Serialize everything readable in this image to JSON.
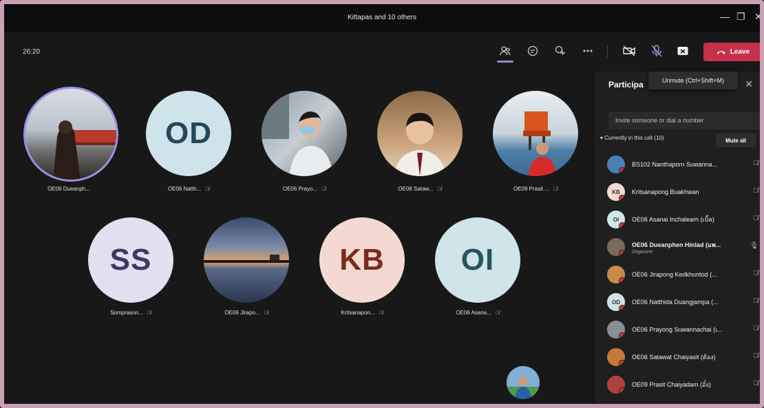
{
  "window": {
    "title": "Kittapas and 10 others",
    "minimize": "—",
    "maximize": "❐",
    "close": "✕"
  },
  "toolbar": {
    "timer": "26:20",
    "leave_label": "Leave",
    "tooltip": "Unmute (Ctrl+Shift+M)",
    "icons": [
      "participants-icon",
      "chat-icon",
      "reactions-icon",
      "more-icon",
      "camera-off-icon",
      "mic-off-icon",
      "share-tray-icon"
    ]
  },
  "stage": {
    "row1": [
      {
        "label": "OE06 Dueanph...",
        "type": "photo",
        "active": true
      },
      {
        "label": "OE06 Natth...",
        "type": "initials",
        "initials": "OD",
        "bg": "#cfe3ea",
        "fg": "#24475a"
      },
      {
        "label": "OE06 Prayo...",
        "type": "photo"
      },
      {
        "label": "OE06 Sataw...",
        "type": "photo"
      },
      {
        "label": "OE09 Prasit ...",
        "type": "photo"
      }
    ],
    "row2": [
      {
        "label": "Somprason...",
        "type": "initials",
        "initials": "SS",
        "bg": "#e2dff0",
        "fg": "#3e3766"
      },
      {
        "label": "OE06 Jirapo...",
        "type": "photo"
      },
      {
        "label": "Kritsanapon...",
        "type": "initials",
        "initials": "KB",
        "bg": "#f4d9d2",
        "fg": "#7a2a1e"
      },
      {
        "label": "OE06 Asana...",
        "type": "initials",
        "initials": "OI",
        "bg": "#cfe5ea",
        "fg": "#27535f"
      }
    ]
  },
  "panel": {
    "title": "Participa",
    "invite_placeholder": "Invite someone or dial a number",
    "section_label": "Currently in this call (10)",
    "mute_all": "Mute all",
    "participants": [
      {
        "name": "BS102 Nanthaporn Suwanna...",
        "initials": "",
        "bg": "#4a7fb5",
        "status": ""
      },
      {
        "name": "Kritsanapong Buakhwan",
        "initials": "KB",
        "bg": "#f4d9d2",
        "status": ""
      },
      {
        "name": "OE06 Asanai Inchalearn (เบิ้ล)",
        "initials": "OI",
        "bg": "#cfe5ea",
        "status": ""
      },
      {
        "name": "OE06 Dueanphen Hinlad (แพ...",
        "initials": "",
        "bg": "#7a6a5a",
        "status": "Organizer"
      },
      {
        "name": "OE06 Jirapong Kedkhuntod (...",
        "initials": "",
        "bg": "#c98a4a",
        "status": ""
      },
      {
        "name": "OE06 Natthida Duangjampa (...",
        "initials": "OD",
        "bg": "#cfe3ea",
        "status": ""
      },
      {
        "name": "OE06 Prayong Suwannachai (เ...",
        "initials": "",
        "bg": "#8a8f95",
        "status": ""
      },
      {
        "name": "OE06 Satawat Chaiyasit (ต้อง)",
        "initials": "",
        "bg": "#c47a3a",
        "status": ""
      },
      {
        "name": "OE09 Prasit Chaiyadam (อั๋ง)",
        "initials": "",
        "bg": "#b04040",
        "status": ""
      }
    ]
  }
}
